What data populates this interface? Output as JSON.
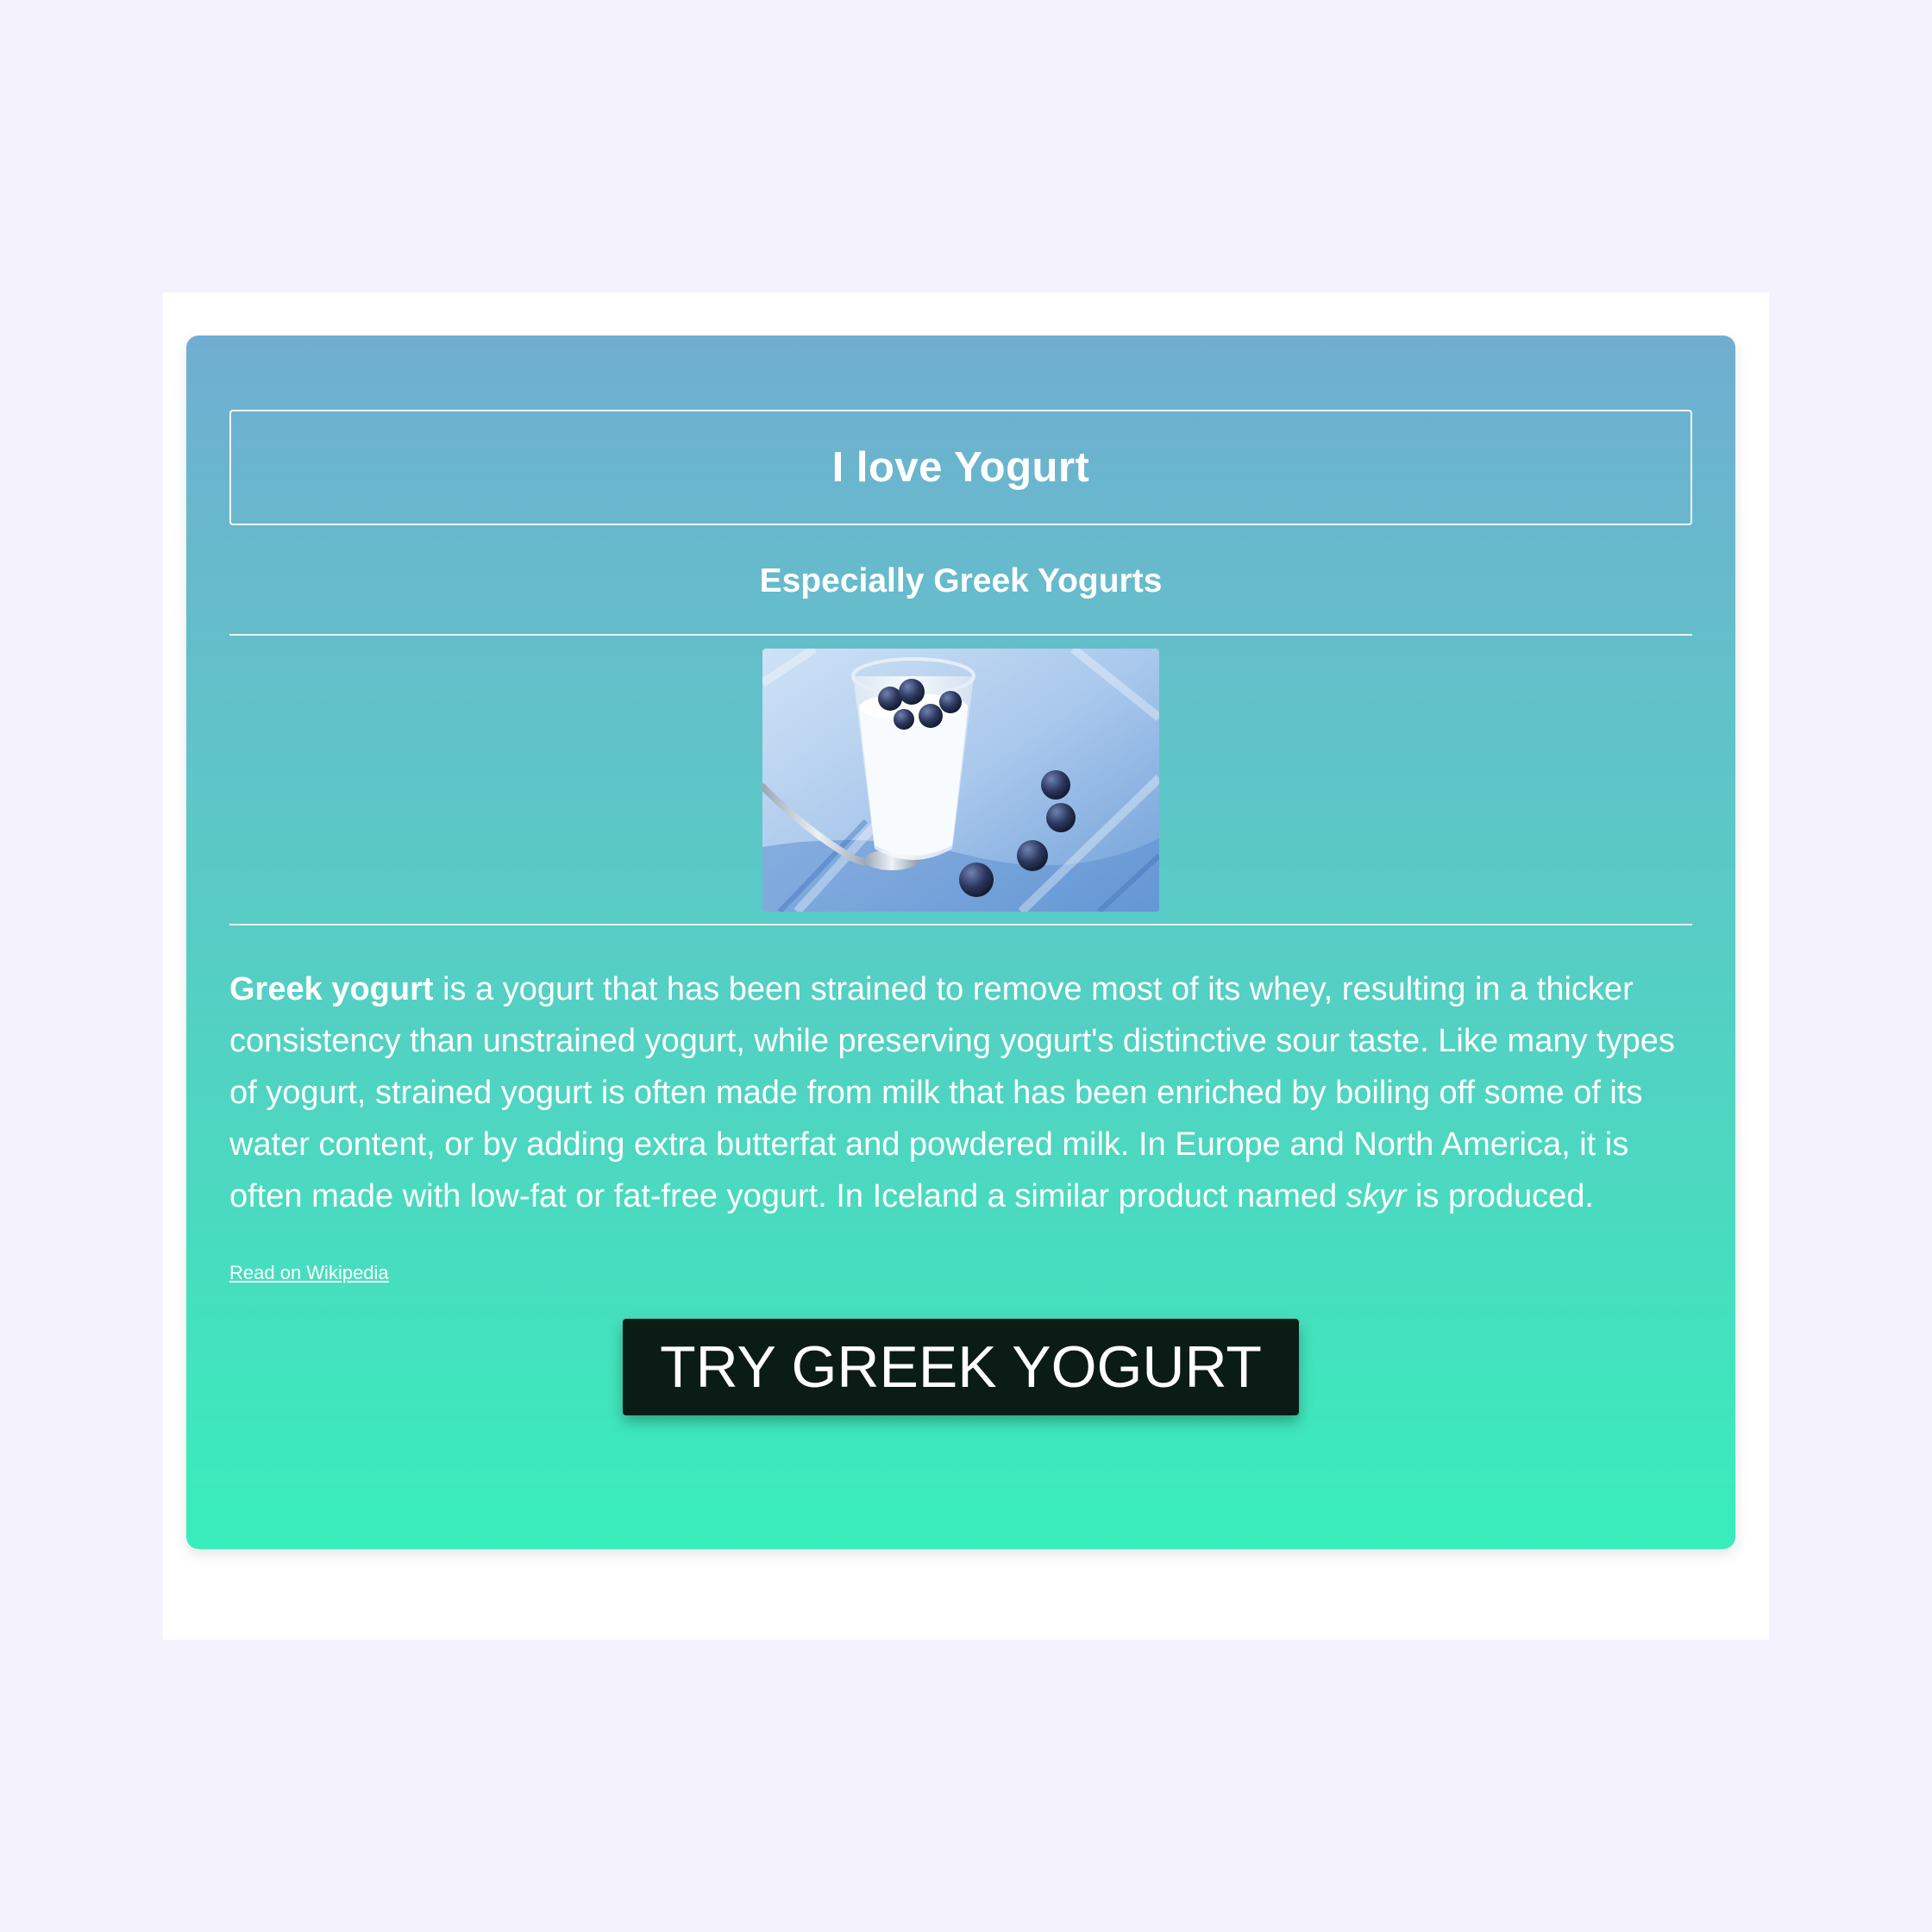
{
  "card": {
    "title": "I love Yogurt",
    "subtitle": "Especially Greek Yogurts",
    "image_alt": "Greek yogurt with blueberries",
    "description": {
      "bold_lead": "Greek yogurt",
      "text_part1": " is a yogurt that has been strained to remove most of its whey, resulting in a thicker consistency than unstrained yogurt, while preserving yogurt's distinctive sour taste. Like many types of yogurt, strained yogurt is often made from milk that has been enriched by boiling off some of its water content, or by adding extra butterfat and powdered milk. In Europe and North America, it is often made with low-fat or fat-free yogurt. In Iceland a similar product named ",
      "italic_word": "skyr",
      "text_part2": " is produced."
    },
    "wiki_link_label": "Read on Wikipedia",
    "cta_label": "TRY GREEK YOGURT"
  },
  "colors": {
    "page_background": "#f4f2fd",
    "frame_background": "#ffffff",
    "gradient_top": "#70aed1",
    "gradient_bottom": "#38eebb",
    "button_background": "#0b1b16",
    "text": "#ffffff"
  }
}
